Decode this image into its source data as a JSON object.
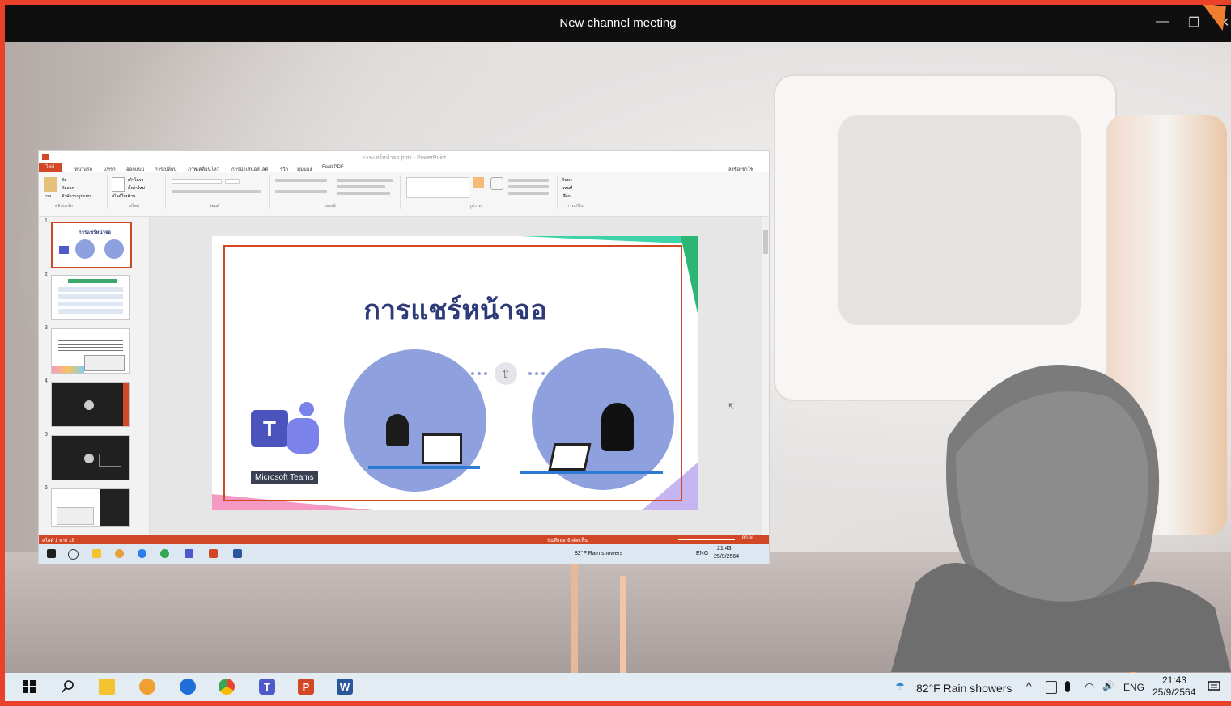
{
  "window": {
    "title": "New channel meeting",
    "minimize_glyph": "—",
    "restore_glyph": "❐",
    "close_glyph": "✕"
  },
  "shared_screen": {
    "ppt_title": "การแชร์หน้าจอ.pptx - PowerPoint",
    "tabs": [
      "ไฟล์",
      "หน้าแรก",
      "แทรก",
      "ออกแบบ",
      "การเปลี่ยน",
      "ภาพเคลื่อนไหว",
      "การนำเสนอสไลด์",
      "รีวิว",
      "มุมมอง",
      "Foxit PDF"
    ],
    "account": "ลงชื่อเข้าใช้",
    "ribbon_groups": [
      "คลิปบอร์ด",
      "สไลด์",
      "ฟอนต์",
      "ย่อหน้า",
      "รูปวาด",
      "การแก้ไข"
    ],
    "ribbon_items": {
      "paste": "วาง",
      "cut": "ตัด",
      "copy": "คัดลอก",
      "format_painter": "ตัวคัดวางรูปแบบ",
      "new_slide": "สไลด์ใหม่",
      "layout": "เค้าโครง",
      "reset": "ตั้งค่าใหม่",
      "section": "ส่วน",
      "find": "ค้นหา",
      "replace": "แทนที่",
      "select": "เลือก"
    },
    "slide_numbers": [
      "1",
      "2",
      "3",
      "4",
      "5",
      "6"
    ],
    "slide": {
      "title": "การแชร์หน้าจอ",
      "teams_label": "Microsoft Teams"
    },
    "status": {
      "left": "สไลด์ 1 จาก 18",
      "right": "บันทึกย่อ  ข้อคิดเห็น",
      "zoom": "80 %"
    },
    "taskbar": {
      "weather": "82°F  Rain showers",
      "lang": "ENG",
      "time": "21:43",
      "date": "25/9/2564"
    }
  },
  "taskbar": {
    "weather": "82°F  Rain showers",
    "lang": "ENG",
    "time": "21:43",
    "date": "25/9/2564",
    "volume_glyph": "🔊",
    "wifi_glyph": "◠",
    "mic_glyph": "🎤",
    "chevron_glyph": "^"
  }
}
